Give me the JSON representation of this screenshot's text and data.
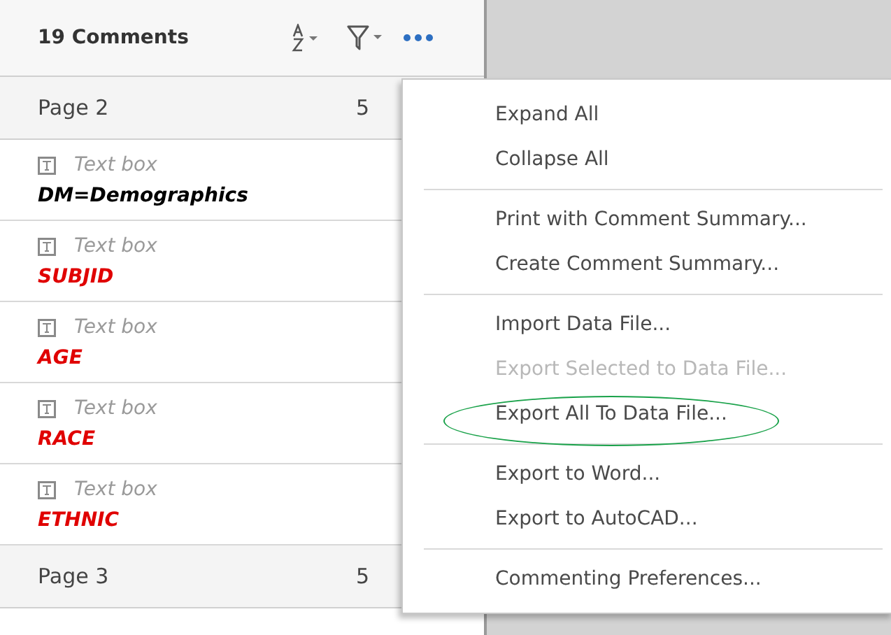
{
  "header": {
    "title": "19 Comments"
  },
  "groups": [
    {
      "label": "Page 2",
      "count": "5",
      "comments": [
        {
          "type": "Text box",
          "text": "DM=Demographics",
          "color": "#000000"
        },
        {
          "type": "Text box",
          "text": "SUBJID",
          "color": "#e00000"
        },
        {
          "type": "Text box",
          "text": "AGE",
          "color": "#e00000"
        },
        {
          "type": "Text box",
          "text": "RACE",
          "color": "#e00000"
        },
        {
          "type": "Text box",
          "text": "ETHNIC",
          "color": "#e00000"
        }
      ]
    },
    {
      "label": "Page 3",
      "count": "5"
    }
  ],
  "menu": {
    "sections": [
      [
        {
          "label": "Expand All",
          "disabled": false,
          "circled": false
        },
        {
          "label": "Collapse All",
          "disabled": false,
          "circled": false
        }
      ],
      [
        {
          "label": "Print with Comment Summary...",
          "disabled": false,
          "circled": false
        },
        {
          "label": "Create Comment Summary...",
          "disabled": false,
          "circled": false
        }
      ],
      [
        {
          "label": "Import Data File...",
          "disabled": false,
          "circled": false
        },
        {
          "label": "Export Selected to Data File...",
          "disabled": true,
          "circled": false
        },
        {
          "label": "Export All To Data File...",
          "disabled": false,
          "circled": true
        }
      ],
      [
        {
          "label": "Export to Word...",
          "disabled": false,
          "circled": false
        },
        {
          "label": "Export to AutoCAD...",
          "disabled": false,
          "circled": false
        }
      ],
      [
        {
          "label": "Commenting Preferences...",
          "disabled": false,
          "circled": false
        }
      ]
    ]
  }
}
